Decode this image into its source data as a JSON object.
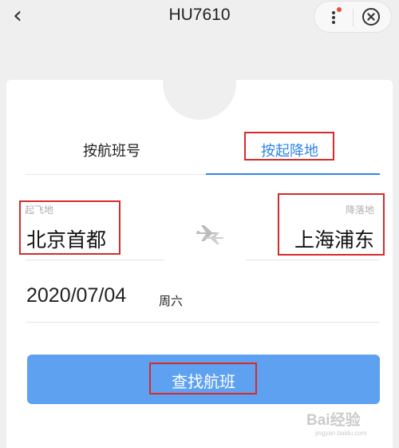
{
  "header": {
    "back_glyph": "‹",
    "title": "HU7610",
    "more_icon": "more-dots-icon",
    "close_icon": "close-circle-icon"
  },
  "tabs": [
    {
      "label": "按航班号",
      "active": false
    },
    {
      "label": "按起降地",
      "active": true
    }
  ],
  "departure": {
    "label": "起飞地",
    "city": "北京首都"
  },
  "arrival": {
    "label": "降落地",
    "city": "上海浦东"
  },
  "swap_icon": "plane-swap-icon",
  "date": {
    "value": "2020/07/04",
    "weekday": "周六"
  },
  "search_button": {
    "label": "查找航班"
  },
  "watermark": {
    "brand": "Bai经验",
    "url": "jingyan.baidu.com"
  },
  "colors": {
    "accent": "#2f86e6",
    "button": "#5da1f0",
    "annotation": "#d72b2b"
  }
}
